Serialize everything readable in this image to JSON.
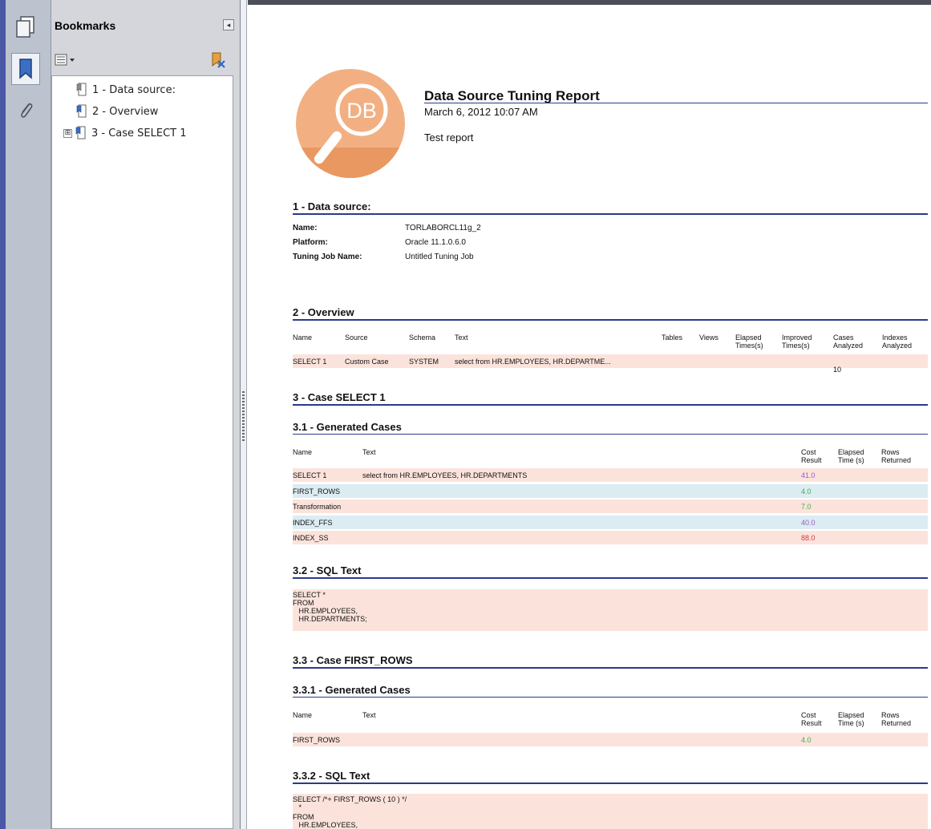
{
  "side_strip": {
    "icons": [
      "pages-icon",
      "bookmark-icon",
      "attachment-icon"
    ]
  },
  "bookmarks": {
    "title": "Bookmarks",
    "items": [
      {
        "label": "1 - Data source:"
      },
      {
        "label": "2 - Overview"
      },
      {
        "label": "3 - Case SELECT 1",
        "expander": "⊞"
      }
    ]
  },
  "report": {
    "logo_text": "DB",
    "title": "Data Source Tuning Report",
    "date": "March 6, 2012 10:07 AM",
    "subtitle": "Test report",
    "s1": {
      "heading": "1 - Data source:",
      "fields": [
        {
          "label": "Name:",
          "value": "TORLABORCL11g_2"
        },
        {
          "label": "Platform:",
          "value": "Oracle 11.1.0.6.0"
        },
        {
          "label": "Tuning Job Name:",
          "value": "Untitled Tuning Job"
        }
      ]
    },
    "s2": {
      "heading": "2 - Overview",
      "columns": [
        "Name",
        "Source",
        "Schema",
        "Text",
        "Tables",
        "Views",
        "Elapsed Times(s)",
        "Improved Times(s)",
        "Cases Analyzed",
        "Indexes Analyzed"
      ],
      "row": [
        "SELECT 1",
        "Custom Case",
        "SYSTEM",
        "select from HR.EMPLOYEES, HR.DEPARTME...",
        "",
        "",
        "",
        "",
        "10",
        ""
      ]
    },
    "s3": {
      "heading": "3 - Case SELECT 1",
      "gen_heading": "3.1 - Generated Cases",
      "columns": [
        "Name",
        "Text",
        "Cost Result",
        "Elapsed Time (s)",
        "Rows Returned"
      ],
      "rows": [
        {
          "name": "SELECT 1",
          "text": "select from HR.EMPLOYEES, HR.DEPARTMENTS",
          "cost": "41.0",
          "cost_color": "#9a5ac8",
          "bg": "pink"
        },
        {
          "name": "FIRST_ROWS",
          "text": "",
          "cost": "4.0",
          "cost_color": "#3fae4a",
          "bg": "blue"
        },
        {
          "name": "Transformation",
          "text": "",
          "cost": "7.0",
          "cost_color": "#3fae4a",
          "bg": "pink"
        },
        {
          "name": "INDEX_FFS",
          "text": "",
          "cost": "40.0",
          "cost_color": "#9a5ac8",
          "bg": "blue"
        },
        {
          "name": "INDEX_SS",
          "text": "",
          "cost": "88.0",
          "cost_color": "#d23a3a",
          "bg": "pink"
        }
      ],
      "sql_heading": "3.2 - SQL Text",
      "sql_lines": [
        "SELECT *",
        "FROM",
        "   HR.EMPLOYEES,",
        "   HR.DEPARTMENTS;"
      ]
    },
    "s33": {
      "heading": "3.3 - Case FIRST_ROWS",
      "gen_heading": "3.3.1 - Generated Cases",
      "columns": [
        "Name",
        "Text",
        "Cost Result",
        "Elapsed Time (s)",
        "Rows Returned"
      ],
      "rows": [
        {
          "name": "FIRST_ROWS",
          "text": "",
          "cost": "4.0",
          "cost_color": "#3fae4a",
          "bg": "pink"
        }
      ],
      "sql_heading": "3.3.2 - SQL Text",
      "sql_lines": [
        "SELECT /*+ FIRST_ROWS ( 10 ) */",
        "   *",
        "FROM",
        "   HR.EMPLOYEES,"
      ]
    }
  },
  "colors": {
    "heading_rule": "#2b3a8a",
    "row_pink": "#fbe3dc",
    "row_blue": "#dcecf3",
    "logo_orange": "#f0a26d"
  }
}
